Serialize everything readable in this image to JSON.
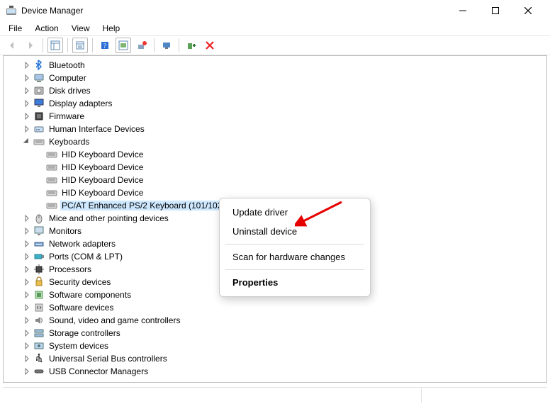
{
  "title": "Device Manager",
  "menu": {
    "items": [
      "File",
      "Action",
      "View",
      "Help"
    ]
  },
  "context_menu": {
    "items": [
      {
        "label": "Update driver",
        "sep": false,
        "bold": false
      },
      {
        "label": "Uninstall device",
        "sep": false,
        "bold": false
      },
      {
        "label": "",
        "sep": true,
        "bold": false
      },
      {
        "label": "Scan for hardware changes",
        "sep": false,
        "bold": false
      },
      {
        "label": "",
        "sep": true,
        "bold": false
      },
      {
        "label": "Properties",
        "sep": false,
        "bold": true
      }
    ]
  },
  "tree": [
    {
      "label": "Bluetooth",
      "icon": "bluetooth",
      "has_children": true,
      "expanded": false,
      "selected": false,
      "depth": 1
    },
    {
      "label": "Computer",
      "icon": "computer",
      "has_children": true,
      "expanded": false,
      "selected": false,
      "depth": 1
    },
    {
      "label": "Disk drives",
      "icon": "disk",
      "has_children": true,
      "expanded": false,
      "selected": false,
      "depth": 1
    },
    {
      "label": "Display adapters",
      "icon": "display",
      "has_children": true,
      "expanded": false,
      "selected": false,
      "depth": 1
    },
    {
      "label": "Firmware",
      "icon": "firmware",
      "has_children": true,
      "expanded": false,
      "selected": false,
      "depth": 1
    },
    {
      "label": "Human Interface Devices",
      "icon": "hid",
      "has_children": true,
      "expanded": false,
      "selected": false,
      "depth": 1
    },
    {
      "label": "Keyboards",
      "icon": "keyboard",
      "has_children": true,
      "expanded": true,
      "selected": false,
      "depth": 1
    },
    {
      "label": "HID Keyboard Device",
      "icon": "keyboard",
      "has_children": false,
      "expanded": false,
      "selected": false,
      "depth": 2
    },
    {
      "label": "HID Keyboard Device",
      "icon": "keyboard",
      "has_children": false,
      "expanded": false,
      "selected": false,
      "depth": 2
    },
    {
      "label": "HID Keyboard Device",
      "icon": "keyboard",
      "has_children": false,
      "expanded": false,
      "selected": false,
      "depth": 2
    },
    {
      "label": "HID Keyboard Device",
      "icon": "keyboard",
      "has_children": false,
      "expanded": false,
      "selected": false,
      "depth": 2
    },
    {
      "label": "PC/AT Enhanced PS/2 Keyboard (101/102-Key)",
      "icon": "keyboard",
      "has_children": false,
      "expanded": false,
      "selected": true,
      "depth": 2
    },
    {
      "label": "Mice and other pointing devices",
      "icon": "mouse",
      "has_children": true,
      "expanded": false,
      "selected": false,
      "depth": 1
    },
    {
      "label": "Monitors",
      "icon": "monitor",
      "has_children": true,
      "expanded": false,
      "selected": false,
      "depth": 1
    },
    {
      "label": "Network adapters",
      "icon": "network",
      "has_children": true,
      "expanded": false,
      "selected": false,
      "depth": 1
    },
    {
      "label": "Ports (COM & LPT)",
      "icon": "port",
      "has_children": true,
      "expanded": false,
      "selected": false,
      "depth": 1
    },
    {
      "label": "Processors",
      "icon": "cpu",
      "has_children": true,
      "expanded": false,
      "selected": false,
      "depth": 1
    },
    {
      "label": "Security devices",
      "icon": "security",
      "has_children": true,
      "expanded": false,
      "selected": false,
      "depth": 1
    },
    {
      "label": "Software components",
      "icon": "swcomp",
      "has_children": true,
      "expanded": false,
      "selected": false,
      "depth": 1
    },
    {
      "label": "Software devices",
      "icon": "swdev",
      "has_children": true,
      "expanded": false,
      "selected": false,
      "depth": 1
    },
    {
      "label": "Sound, video and game controllers",
      "icon": "sound",
      "has_children": true,
      "expanded": false,
      "selected": false,
      "depth": 1
    },
    {
      "label": "Storage controllers",
      "icon": "storage",
      "has_children": true,
      "expanded": false,
      "selected": false,
      "depth": 1
    },
    {
      "label": "System devices",
      "icon": "system",
      "has_children": true,
      "expanded": false,
      "selected": false,
      "depth": 1
    },
    {
      "label": "Universal Serial Bus controllers",
      "icon": "usb",
      "has_children": true,
      "expanded": false,
      "selected": false,
      "depth": 1
    },
    {
      "label": "USB Connector Managers",
      "icon": "usb-c",
      "has_children": true,
      "expanded": false,
      "selected": false,
      "depth": 1
    }
  ]
}
